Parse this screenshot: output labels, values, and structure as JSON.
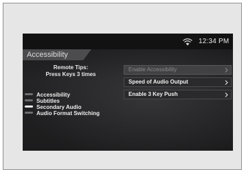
{
  "status": {
    "time": "12:34 PM",
    "wifi_icon": "wifi-icon"
  },
  "screen_title": "Accessibility",
  "tips": {
    "line1": "Remote Tips:",
    "line2": "Press Keys 3 times"
  },
  "menu": [
    {
      "label": "Enable Accessibility",
      "disabled": true
    },
    {
      "label": "Speed of Audio Output",
      "disabled": false
    },
    {
      "label": "Enable 3 Key Push",
      "disabled": false
    }
  ],
  "features": [
    {
      "label": "Accessibility",
      "on": false
    },
    {
      "label": "Subtitles",
      "on": false
    },
    {
      "label": "Secondary Audio",
      "on": true
    },
    {
      "label": "Audio Format Switching",
      "on": false
    }
  ],
  "colors": {
    "screen_bg": "#1d1d1f",
    "text": "#eeeeee",
    "disabled_text": "#8a8a8c"
  }
}
